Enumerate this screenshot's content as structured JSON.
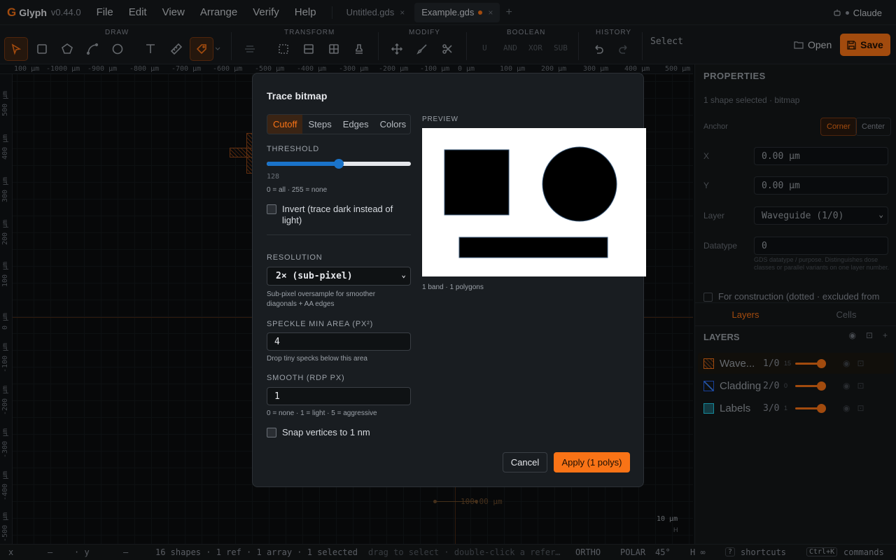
{
  "app": {
    "logo": "G",
    "name": "Glyph",
    "version": "v0.44.0"
  },
  "menu": [
    "File",
    "Edit",
    "View",
    "Arrange",
    "Verify",
    "Help"
  ],
  "tabs": [
    {
      "label": "Untitled.gds",
      "close": "×"
    },
    {
      "label": "Example.gds",
      "close": "×"
    }
  ],
  "user": {
    "name": "Claude"
  },
  "toolbar": {
    "groups": {
      "draw": "DRAW",
      "transform": "TRANSFORM",
      "modify": "MODIFY",
      "boolean": "BOOLEAN",
      "history": "HISTORY"
    },
    "boolean_ops": [
      "U",
      "AND",
      "XOR",
      "SUB"
    ],
    "mode_label": "Select",
    "open_label": "Open",
    "save_label": "Save"
  },
  "rulers": {
    "h": [
      "100 µm",
      "-1000 µm",
      "-900 µm",
      "-800 µm",
      "-700 µm",
      "-600 µm",
      "-500 µm",
      "-400 µm",
      "-300 µm",
      "-200 µm",
      "-100 µm",
      "0 µm",
      "100 µm",
      "200 µm",
      "300 µm",
      "400 µm",
      "500 µm"
    ],
    "v": [
      "500 µm",
      "400 µm",
      "300 µm",
      "200 µm",
      "100 µm",
      "0 µm",
      "-100 µm",
      "-200 µm",
      "-300 µm",
      "-400 µm",
      "-500 µm"
    ]
  },
  "canvas": {
    "scalebar": "100.00 µm",
    "mini_scale": "10 µm",
    "mini_h": "H"
  },
  "properties": {
    "title": "PROPERTIES",
    "subtitle": "1 shape selected · bitmap",
    "anchor_label": "Anchor",
    "anchor_options": [
      "Corner",
      "Center"
    ],
    "x_label": "X",
    "x_value": "0.00 µm",
    "y_label": "Y",
    "y_value": "0.00 µm",
    "layer_label": "Layer",
    "layer_value": "Waveguide (1/0)",
    "datatype_label": "Datatype",
    "datatype_value": "0",
    "datatype_hint": "GDS datatype / purpose. Distinguishes dose classes or parallel variants on one layer number.",
    "construction": "For construction (dotted · excluded from"
  },
  "panel_tabs": [
    "Layers",
    "Cells"
  ],
  "layers": {
    "title": "LAYERS",
    "items": [
      {
        "name": "Wave...",
        "num": "1/0",
        "count": "15",
        "color": "#f97316"
      },
      {
        "name": "Cladding",
        "num": "2/0",
        "count": "0",
        "color": "#3b82f6"
      },
      {
        "name": "Labels",
        "num": "3/0",
        "count": "1",
        "color": "#22d3ee"
      }
    ]
  },
  "status": {
    "x_label": "x",
    "x_val": "—",
    "y_label": "· y",
    "y_val": "—",
    "counts": "16 shapes · 1 ref · 1 array · 1 selected",
    "hint": "drag to select · double-click a refer…",
    "ortho": "ORTHO",
    "polar": "POLAR",
    "angle": "45°",
    "h": "H ∞",
    "shortcuts_key": "?",
    "shortcuts": "shortcuts",
    "commands_key": "Ctrl+K",
    "commands": "commands"
  },
  "dialog": {
    "title": "Trace bitmap",
    "tabs": [
      "Cutoff",
      "Steps",
      "Edges",
      "Colors"
    ],
    "threshold_label": "THRESHOLD",
    "threshold_value": 128,
    "threshold_display": "128",
    "threshold_max": 255,
    "threshold_hint": "0 = all · 255 = none",
    "invert_label": "Invert (trace dark instead of light)",
    "resolution_label": "RESOLUTION",
    "resolution_value": "2× (sub-pixel)",
    "resolution_hint": "Sub-pixel oversample for smoother diagonals + AA edges",
    "speckle_label": "SPECKLE MIN AREA (PX²)",
    "speckle_value": "4",
    "speckle_hint": "Drop tiny specks below this area",
    "smooth_label": "SMOOTH (RDP PX)",
    "smooth_value": "1",
    "smooth_hint": "0 = none · 1 = light · 5 = aggressive",
    "snap_label": "Snap vertices to 1 nm",
    "preview_label": "PREVIEW",
    "preview_info": "1 band · 1 polygons",
    "cancel": "Cancel",
    "apply": "Apply (1 polys)"
  }
}
